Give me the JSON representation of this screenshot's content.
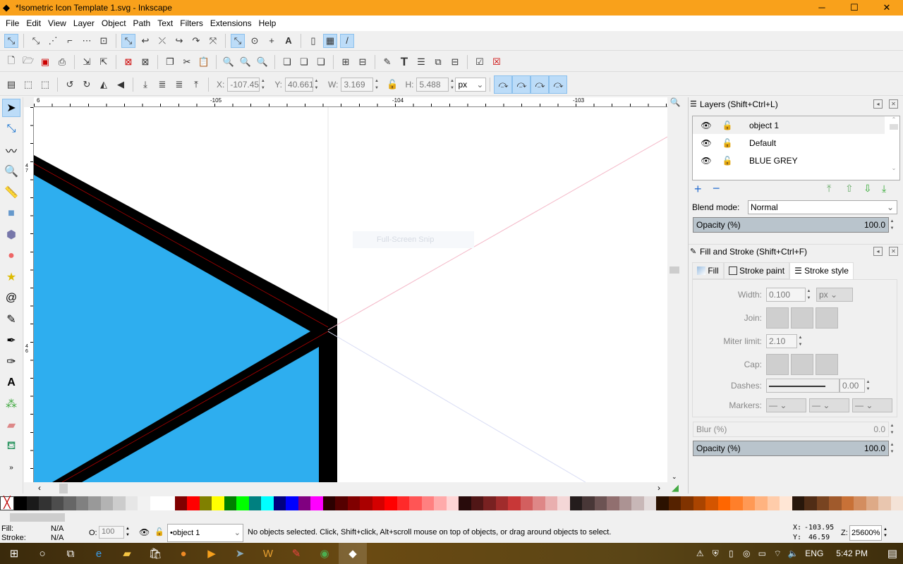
{
  "window": {
    "title": "*Isometric Icon Template 1.svg - Inkscape",
    "minimize": "─",
    "maximize": "☐",
    "close": "✕"
  },
  "menu": [
    "File",
    "Edit",
    "View",
    "Layer",
    "Object",
    "Path",
    "Text",
    "Filters",
    "Extensions",
    "Help"
  ],
  "tool_controls": {
    "x_label": "X:",
    "x": "-107.45",
    "y_label": "Y:",
    "y": "40.661",
    "w_label": "W:",
    "w": "3.169",
    "h_label": "H:",
    "h": "5.488",
    "unit": "px"
  },
  "ruler": {
    "top": [
      "6",
      "-105",
      "-104",
      "-103"
    ],
    "left": [
      "4 7",
      "4 6"
    ]
  },
  "canvas": {
    "overlay_text": "Full-Screen Snip",
    "fill_color": "#2eaeef",
    "stroke_color": "#000000"
  },
  "layers_panel": {
    "title": "Layers (Shift+Ctrl+L)",
    "layers": [
      "object 1",
      "Default",
      "BLUE GREY"
    ],
    "blend_label": "Blend mode:",
    "blend_value": "Normal",
    "opacity_label": "Opacity (%)",
    "opacity_value": "100.0"
  },
  "fill_stroke_panel": {
    "title": "Fill and Stroke (Shift+Ctrl+F)",
    "tabs": [
      "Fill",
      "Stroke paint",
      "Stroke style"
    ],
    "active_tab": "Stroke style",
    "width_label": "Width:",
    "width": "0.100",
    "width_unit": "px",
    "join_label": "Join:",
    "miter_label": "Miter limit:",
    "miter": "2.10",
    "cap_label": "Cap:",
    "dashes_label": "Dashes:",
    "dash_offset": "0.00",
    "markers_label": "Markers:",
    "blur_label": "Blur (%)",
    "blur_value": "0.0",
    "opacity_label": "Opacity (%)",
    "opacity_value": "100.0"
  },
  "palette": [
    "#000000",
    "#1a1a1a",
    "#333333",
    "#4d4d4d",
    "#666666",
    "#808080",
    "#999999",
    "#b3b3b3",
    "#cccccc",
    "#e6e6e6",
    "#f2f2f2",
    "#ffffff",
    "#ffffff",
    "#800000",
    "#ff0000",
    "#808000",
    "#ffff00",
    "#008000",
    "#00ff00",
    "#008080",
    "#00ffff",
    "#000080",
    "#0000ff",
    "#800080",
    "#ff00ff",
    "#2b0000",
    "#550000",
    "#800000",
    "#aa0000",
    "#d40000",
    "#ff0000",
    "#ff2a2a",
    "#ff5555",
    "#ff8080",
    "#ffaaaa",
    "#ffd5d5",
    "#280b0b",
    "#501616",
    "#782121",
    "#a02c2c",
    "#c83737",
    "#d35f5f",
    "#de8787",
    "#e9afaf",
    "#f4d7d7",
    "#241c1c",
    "#483737",
    "#6c5353",
    "#916f6f",
    "#ac9393",
    "#c8b7b7",
    "#e3dbdb",
    "#2b1100",
    "#552200",
    "#803300",
    "#aa4400",
    "#d45500",
    "#ff6600",
    "#ff7f2a",
    "#ff9955",
    "#ffb380",
    "#ffccaa",
    "#ffe6d5",
    "#28170b",
    "#502d16",
    "#784421",
    "#a05a2c",
    "#c87137",
    "#d38d5f",
    "#deaa87",
    "#e9c6af",
    "#f4e3d7"
  ],
  "status": {
    "fill_label": "Fill:",
    "fill_value": "N/A",
    "stroke_label": "Stroke:",
    "stroke_value": "N/A",
    "opacity_label": "O:",
    "opacity_value": "100",
    "layer": "•object 1",
    "message": "No objects selected. Click, Shift+click, Alt+scroll mouse on top of objects, or drag around objects to select.",
    "x_label": "X:",
    "x": "-103.95",
    "y_label": "Y:",
    "y": "46.59",
    "zoom_label": "Z:",
    "zoom": "25600%"
  },
  "taskbar": {
    "lang": "ENG",
    "time": "5:42 PM"
  }
}
